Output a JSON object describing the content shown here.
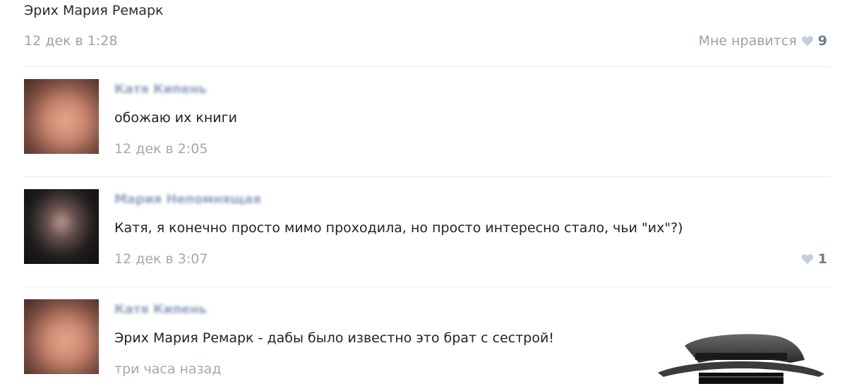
{
  "post": {
    "text": "Эрих Мария Ремарк",
    "date": "12 дек в 1:28",
    "like_label": "Мне нравится",
    "like_count": "9"
  },
  "comments": [
    {
      "author": "Катя Кипень",
      "text": "обожаю их книги",
      "date": "12 дек в 2:05",
      "likes": ""
    },
    {
      "author": "Мария Непомнящая",
      "text": "Катя, я конечно просто мимо проходила, но просто интересно стало, чьи \"их\"?)",
      "date": "12 дек в 3:07",
      "likes": "1"
    },
    {
      "author": "Катя Кипень",
      "text": "Эрих Мария Ремарк - дабы было известно это брат с сестрой!",
      "date": "три часа назад",
      "likes": ""
    }
  ],
  "colors": {
    "heart": "#c7d0d9",
    "link_blue": "#8fa3bc",
    "muted_gray": "#9aa1a8"
  }
}
